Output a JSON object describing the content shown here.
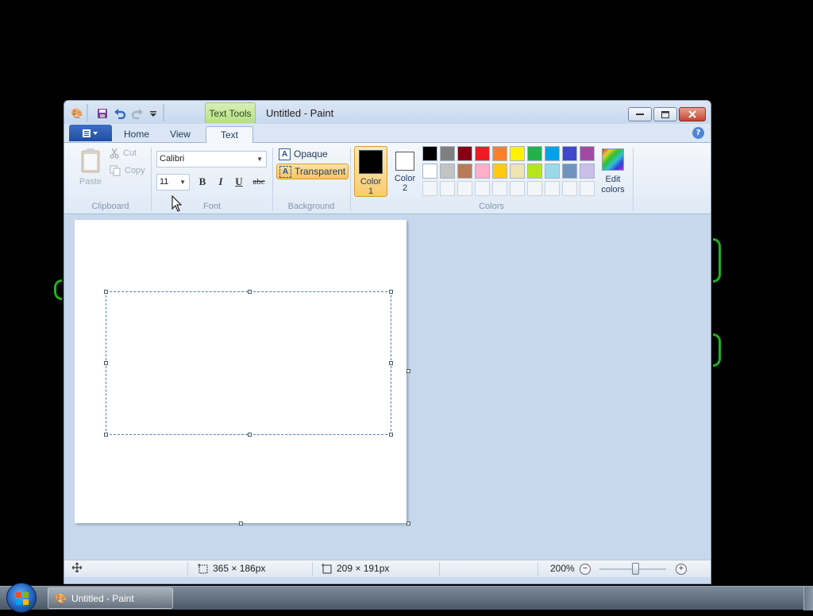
{
  "window": {
    "title": "Untitled - Paint",
    "context_tab": "Text Tools",
    "controls": {
      "minimize": "minimize",
      "maximize": "maximize",
      "close": "close"
    }
  },
  "tabs": [
    {
      "label": "Home",
      "active": false
    },
    {
      "label": "View",
      "active": false
    },
    {
      "label": "Text",
      "active": true
    }
  ],
  "clipboard": {
    "paste": "Paste",
    "cut": "Cut",
    "copy": "Copy",
    "group_label": "Clipboard"
  },
  "font": {
    "family": "Calibri",
    "size": "11",
    "bold": "B",
    "italic": "I",
    "underline": "U",
    "strikethrough": "abc",
    "group_label": "Font"
  },
  "background": {
    "opaque": "Opaque",
    "transparent": "Transparent",
    "selected": "transparent",
    "group_label": "Background"
  },
  "colors": {
    "color1_label": "Color 1",
    "color1_value": "#000000",
    "color2_label": "Color 2",
    "color2_value": "#ffffff",
    "edit_colors": "Edit colors",
    "group_label": "Colors",
    "palette_row1": [
      "#000000",
      "#7f7f7f",
      "#880015",
      "#ed1c24",
      "#ff7f27",
      "#fff200",
      "#22b14c",
      "#00a2e8",
      "#3f48cc",
      "#a349a4"
    ],
    "palette_row2": [
      "#ffffff",
      "#c3c3c3",
      "#b97a57",
      "#ffaec9",
      "#ffc90e",
      "#efe4b0",
      "#b5e61d",
      "#99d9ea",
      "#7092be",
      "#c8bfe7"
    ]
  },
  "statusbar": {
    "selection_size": "365 × 186px",
    "image_size": "209 × 191px",
    "zoom": "200%",
    "zoom_fraction": 0.55
  },
  "taskbar": {
    "task_label": "Untitled - Paint"
  }
}
